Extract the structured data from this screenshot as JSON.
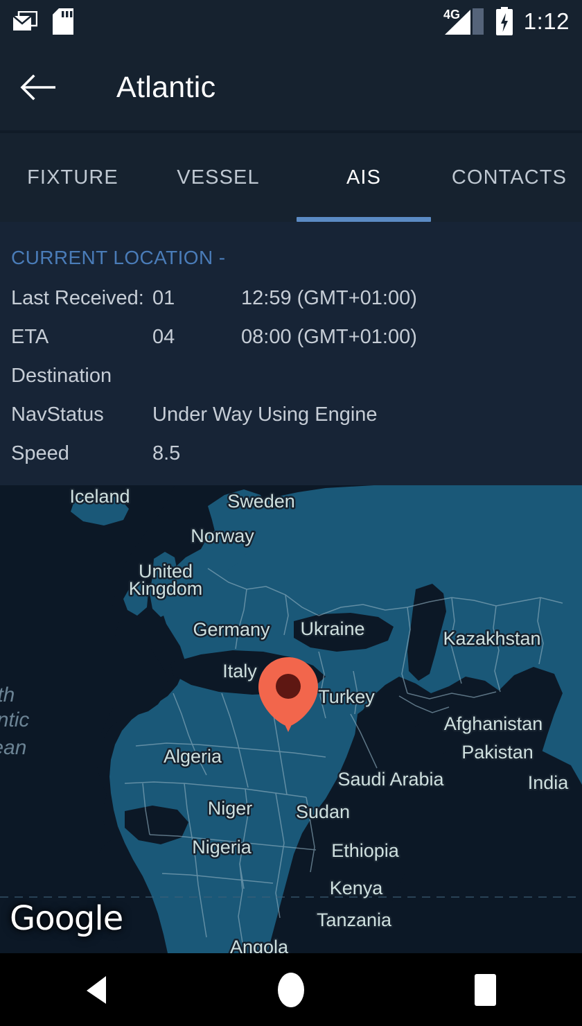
{
  "status_bar": {
    "icons": [
      "mail-icon",
      "sd-card-icon",
      "signal-4g-icon",
      "battery-charging-icon"
    ],
    "network_label": "4G",
    "time": "1:12"
  },
  "app_bar": {
    "back_icon": "arrow-back-icon",
    "title": "Atlantic"
  },
  "tabs": [
    {
      "label": "FIXTURE",
      "active": false
    },
    {
      "label": "VESSEL",
      "active": false
    },
    {
      "label": "AIS",
      "active": true
    },
    {
      "label": "CONTACTS",
      "active": false
    }
  ],
  "info": {
    "section_title": "CURRENT LOCATION -",
    "rows": [
      {
        "label": "Last Received:",
        "value1": "01",
        "value2": "12:59 (GMT+01:00)"
      },
      {
        "label": "ETA",
        "value1": "04",
        "value2": "08:00 (GMT+01:00)"
      },
      {
        "label": "Destination",
        "value1": "",
        "value2": ""
      },
      {
        "label": "NavStatus",
        "value1": "",
        "value2": "Under Way Using Engine"
      },
      {
        "label": "Speed",
        "value1": "",
        "value2": "8.5"
      }
    ]
  },
  "map": {
    "attribution": "Google",
    "marker": {
      "name": "vessel-location-marker",
      "color": "#F2664C",
      "dot_color": "#5E1712"
    },
    "ocean_label": "North Atlantic Ocean",
    "country_labels": [
      "Iceland",
      "Sweden",
      "Norway",
      "United",
      "Kingdom",
      "Germany",
      "Ukraine",
      "Kazakhstan",
      "Italy",
      "Turkey",
      "Afghanistan",
      "Pakistan",
      "Algeria",
      "Saudi Arabia",
      "India",
      "Niger",
      "Sudan",
      "Nigeria",
      "Ethiopia",
      "Kenya",
      "Tanzania",
      "Angola"
    ]
  },
  "nav_bar": {
    "buttons": [
      "back-triangle-icon",
      "home-circle-icon",
      "recents-square-icon"
    ]
  },
  "colors": {
    "app_background": "#16222F",
    "content_background": "#172436",
    "accent": "#5B8BC4",
    "section_title": "#4A7CB8",
    "text_primary": "#FFFFFF",
    "text_secondary": "#C6CDD6",
    "map_water": "#0C1826",
    "map_land": "#1A5878",
    "map_border": "#8FAFC0",
    "marker": "#F2664C"
  }
}
